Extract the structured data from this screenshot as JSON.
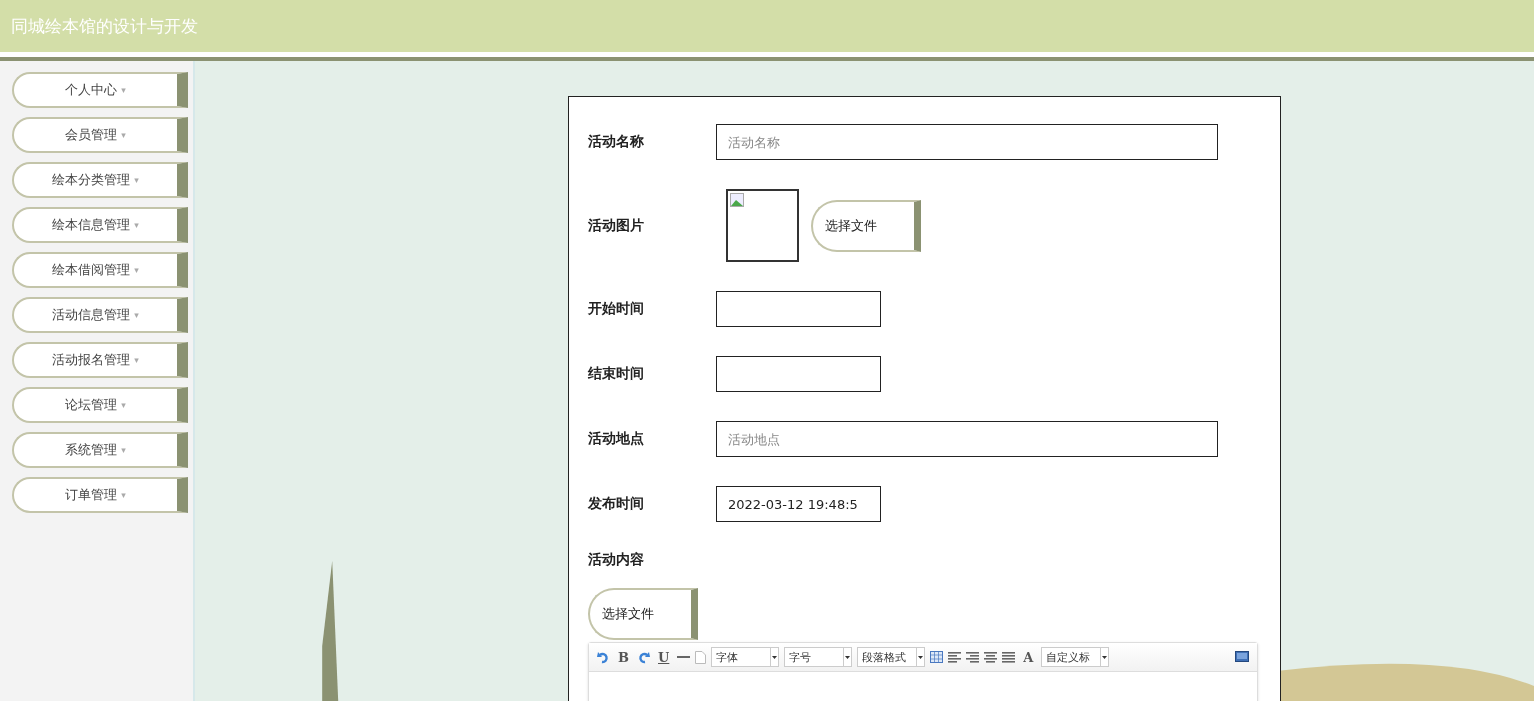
{
  "header": {
    "title": "同城绘本馆的设计与开发"
  },
  "sidebar": {
    "items": [
      {
        "label": "个人中心",
        "caret": "▾"
      },
      {
        "label": "会员管理",
        "caret": "▾"
      },
      {
        "label": "绘本分类管理",
        "caret": "▾"
      },
      {
        "label": "绘本信息管理",
        "caret": "▾"
      },
      {
        "label": "绘本借阅管理",
        "caret": "▾"
      },
      {
        "label": "活动信息管理",
        "caret": "▾"
      },
      {
        "label": "活动报名管理",
        "caret": "▾"
      },
      {
        "label": "论坛管理",
        "caret": "▾"
      },
      {
        "label": "系统管理",
        "caret": "▾"
      },
      {
        "label": "订单管理",
        "caret": "▾"
      }
    ]
  },
  "form": {
    "fields": [
      {
        "kind": "long",
        "label": "活动名称",
        "placeholder": "活动名称"
      },
      {
        "kind": "image",
        "label": "活动图片",
        "button": "选择文件"
      },
      {
        "kind": "short",
        "label": "开始时间"
      },
      {
        "kind": "short",
        "label": "结束时间"
      },
      {
        "kind": "long",
        "label": "活动地点",
        "placeholder": "活动地点"
      },
      {
        "kind": "short",
        "label": "发布时间",
        "value": "2022-03-12 19:48:5"
      },
      {
        "kind": "editor",
        "label": "活动内容",
        "button": "选择文件"
      }
    ],
    "editor_toolbar": [
      {
        "kind": "undo"
      },
      {
        "kind": "bold",
        "label": "B"
      },
      {
        "kind": "redo"
      },
      {
        "kind": "underline",
        "label": "U"
      },
      {
        "kind": "rule"
      },
      {
        "kind": "page"
      },
      {
        "kind": "select",
        "label": "字体"
      },
      {
        "kind": "select",
        "label": "字号"
      },
      {
        "kind": "select",
        "label": "段落格式"
      },
      {
        "kind": "table"
      },
      {
        "kind": "alignleft"
      },
      {
        "kind": "alignright"
      },
      {
        "kind": "aligncenter"
      },
      {
        "kind": "justify"
      },
      {
        "kind": "color",
        "label": "A"
      },
      {
        "kind": "select",
        "label": "自定义标"
      },
      {
        "kind": "fullscreen"
      }
    ]
  }
}
